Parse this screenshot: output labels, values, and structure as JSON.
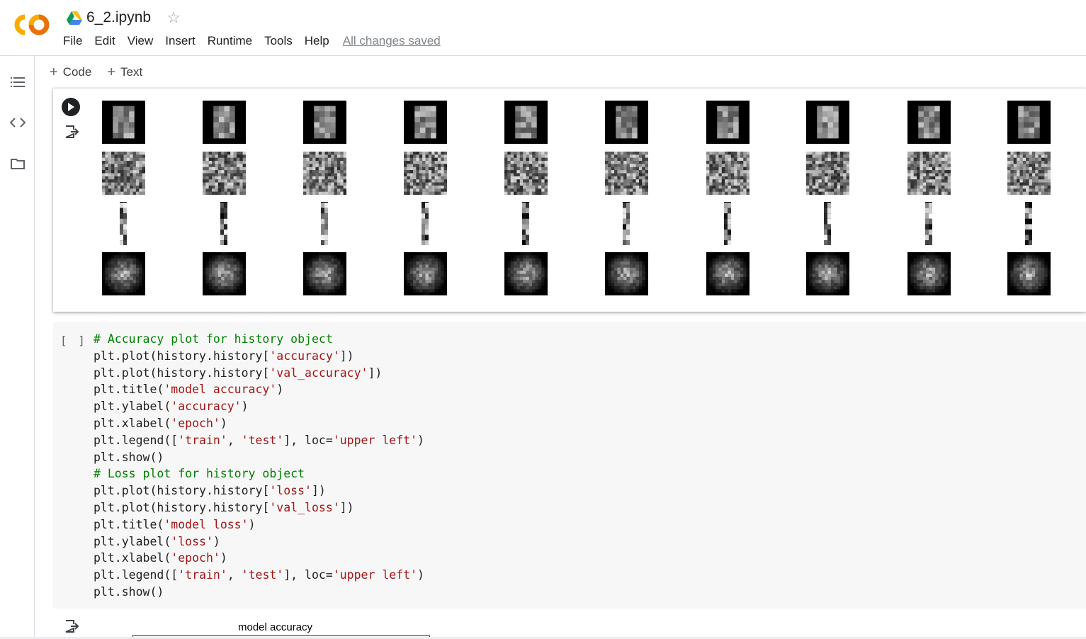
{
  "header": {
    "notebook_title": "6_2.ipynb",
    "menu": [
      "File",
      "Edit",
      "View",
      "Insert",
      "Runtime",
      "Tools",
      "Help"
    ],
    "saved_status": "All changes saved",
    "logo_icon": "colab-logo",
    "brand_colors": {
      "logo_orange": "#f9ab00",
      "logo_dark_orange": "#e8710a"
    }
  },
  "rail": {
    "icons": [
      "table-of-contents-icon",
      "code-snippets-icon",
      "files-folder-icon"
    ]
  },
  "toolbar": {
    "add_code_label": "Code",
    "add_text_label": "Text"
  },
  "output_cell": {
    "rows": [
      "original",
      "noisy",
      "encoded",
      "reconstructed"
    ],
    "columns": 10
  },
  "code_cell": {
    "execution_indicator": "[ ]",
    "lines": [
      [
        {
          "t": "# Accuracy plot for history object",
          "k": "com"
        }
      ],
      [
        {
          "t": "plt.plot(history.history[",
          "k": "n"
        },
        {
          "t": "'accuracy'",
          "k": "str"
        },
        {
          "t": "])",
          "k": "n"
        }
      ],
      [
        {
          "t": "plt.plot(history.history[",
          "k": "n"
        },
        {
          "t": "'val_accuracy'",
          "k": "str"
        },
        {
          "t": "])",
          "k": "n"
        }
      ],
      [
        {
          "t": "plt.title(",
          "k": "n"
        },
        {
          "t": "'model accuracy'",
          "k": "str"
        },
        {
          "t": ")",
          "k": "n"
        }
      ],
      [
        {
          "t": "plt.ylabel(",
          "k": "n"
        },
        {
          "t": "'accuracy'",
          "k": "str"
        },
        {
          "t": ")",
          "k": "n"
        }
      ],
      [
        {
          "t": "plt.xlabel(",
          "k": "n"
        },
        {
          "t": "'epoch'",
          "k": "str"
        },
        {
          "t": ")",
          "k": "n"
        }
      ],
      [
        {
          "t": "plt.legend([",
          "k": "n"
        },
        {
          "t": "'train'",
          "k": "str"
        },
        {
          "t": ", ",
          "k": "n"
        },
        {
          "t": "'test'",
          "k": "str"
        },
        {
          "t": "], loc=",
          "k": "n"
        },
        {
          "t": "'upper left'",
          "k": "str"
        },
        {
          "t": ")",
          "k": "n"
        }
      ],
      [
        {
          "t": "plt.show()",
          "k": "n"
        }
      ],
      [
        {
          "t": "# Loss plot for history object",
          "k": "com"
        }
      ],
      [
        {
          "t": "plt.plot(history.history[",
          "k": "n"
        },
        {
          "t": "'loss'",
          "k": "str"
        },
        {
          "t": "])",
          "k": "n"
        }
      ],
      [
        {
          "t": "plt.plot(history.history[",
          "k": "n"
        },
        {
          "t": "'val_loss'",
          "k": "str"
        },
        {
          "t": "])",
          "k": "n"
        }
      ],
      [
        {
          "t": "plt.title(",
          "k": "n"
        },
        {
          "t": "'model loss'",
          "k": "str"
        },
        {
          "t": ")",
          "k": "n"
        }
      ],
      [
        {
          "t": "plt.ylabel(",
          "k": "n"
        },
        {
          "t": "'loss'",
          "k": "str"
        },
        {
          "t": ")",
          "k": "n"
        }
      ],
      [
        {
          "t": "plt.xlabel(",
          "k": "n"
        },
        {
          "t": "'epoch'",
          "k": "str"
        },
        {
          "t": ")",
          "k": "n"
        }
      ],
      [
        {
          "t": "plt.legend([",
          "k": "n"
        },
        {
          "t": "'train'",
          "k": "str"
        },
        {
          "t": ", ",
          "k": "n"
        },
        {
          "t": "'test'",
          "k": "str"
        },
        {
          "t": "], loc=",
          "k": "n"
        },
        {
          "t": "'upper left'",
          "k": "str"
        },
        {
          "t": ")",
          "k": "n"
        }
      ],
      [
        {
          "t": "plt.show()",
          "k": "n"
        }
      ]
    ]
  },
  "plot_output": {
    "title": "model accuracy"
  }
}
